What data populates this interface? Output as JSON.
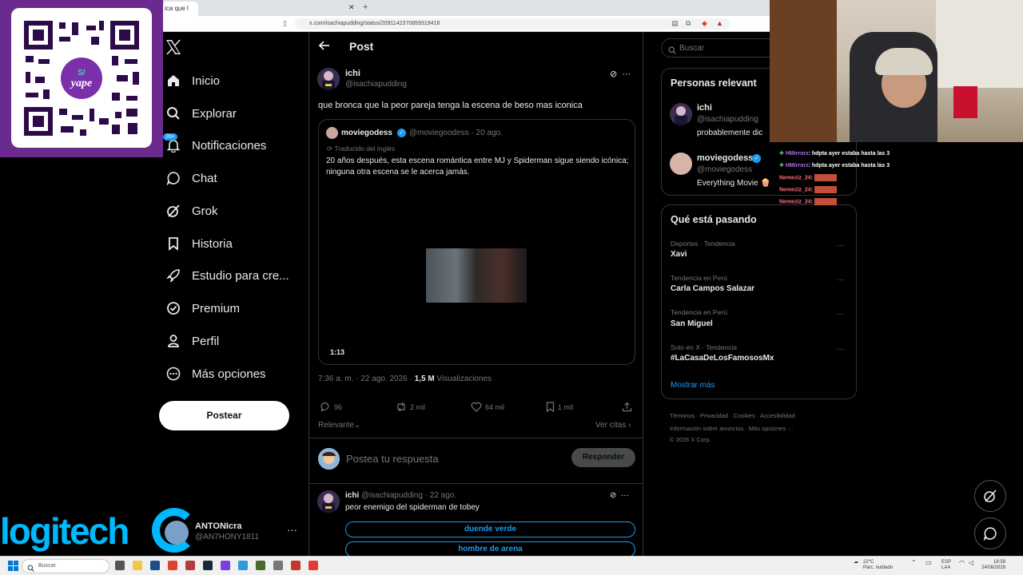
{
  "browser": {
    "tab_title": "ica que l",
    "address": "x.com/isachiapudding/status/2091142370859319416"
  },
  "overlays": {
    "qr_brand": "yape",
    "qr_currency": "S/",
    "logo_text": "logitech"
  },
  "nav": {
    "items": [
      {
        "label": "Inicio",
        "icon": "home-icon"
      },
      {
        "label": "Explorar",
        "icon": "search-icon"
      },
      {
        "label": "Notificaciones",
        "icon": "bell-icon",
        "badge": "20+"
      },
      {
        "label": "Chat",
        "icon": "chat-icon"
      },
      {
        "label": "Grok",
        "icon": "grok-icon"
      },
      {
        "label": "Historia",
        "icon": "bookmark-icon"
      },
      {
        "label": "Estudio para cre...",
        "icon": "rocket-icon"
      },
      {
        "label": "Premium",
        "icon": "verified-icon"
      },
      {
        "label": "Perfil",
        "icon": "person-icon"
      },
      {
        "label": "Más opciones",
        "icon": "more-circle-icon"
      }
    ],
    "post_button": "Postear",
    "account": {
      "name": "ANTONIcra",
      "handle": "@AN7HONY1811"
    }
  },
  "post": {
    "header": "Post",
    "author_name": "ichi",
    "author_handle": "@isachiapudding",
    "text": "que bronca que la peor pareja tenga la escena de beso mas iconica",
    "quote": {
      "name": "moviegodess",
      "handle": "@moviegoodess · 20 ago.",
      "translated": "Traducido del inglés",
      "text": "20 años después, esta escena romántica entre MJ y Spiderman sigue siendo icónica; ninguna otra escena se le acerca jamás.",
      "duration": "1:13"
    },
    "time": "7:36 a. m. · 22 ago. 2026 · ",
    "views_count": "1,5 M",
    "views_label": " Visualizaciones",
    "stats": {
      "replies": "96",
      "reposts": "2 mil",
      "likes": "64 mil",
      "bookmarks": "1 mil"
    },
    "sort": "Relevante",
    "quotes_link": "Ver citas ›",
    "reply_placeholder": "Postea tu respuesta",
    "reply_button": "Responder"
  },
  "reply": {
    "name": "ichi",
    "meta": " @isachiapudding · 22 ago.",
    "text": "peor enemigo del spiderman de tobey",
    "options": [
      "duende verde",
      "hombre de arena"
    ]
  },
  "sidebar": {
    "search_placeholder": "Buscar",
    "people_title": "Personas relevant",
    "people": [
      {
        "name": "ichi",
        "handle": "@isachiapudding",
        "bio": "probablemente dic"
      },
      {
        "name": "moviegodess",
        "handle": "@moviegodess",
        "bio": "Everything Movie 🍿"
      }
    ],
    "trends_title": "Qué está pasando",
    "trends": [
      {
        "category": "Deportes · Tendencia",
        "name": "Xavi"
      },
      {
        "category": "Tendencia en Perú",
        "name": "Carla Campos Salazar"
      },
      {
        "category": "Tendencia en Perú",
        "name": "San Miguel"
      },
      {
        "category": "Solo en X · Tendencia",
        "name": "#LaCasaDeLosFamososMx"
      }
    ],
    "show_more": "Mostrar más",
    "footer_1": "Términos  ·  Privacidad  ·  Cookies  ·  Accesibilidad  ·",
    "footer_2": "Información sobre anuncios  ·  Más opciones ···",
    "footer_3": "© 2026 X Corp."
  },
  "chat": [
    {
      "user": "HMirrorz",
      "msg": ": hdpta ayer estaba hasta las 3"
    },
    {
      "user": "HMirrorz",
      "msg": ": hdpta ayer estaba hasta las 3"
    },
    {
      "user": "Nemeziz_24",
      "msg": ":"
    },
    {
      "user": "Nemeziz_24",
      "msg": ":"
    },
    {
      "user": "Nemeziz_24",
      "msg": ":"
    }
  ],
  "taskbar": {
    "search": "Buscar",
    "weather": "22°C",
    "weather_desc": "Parc. nublado",
    "lang": "ESP",
    "lang2": "LAA",
    "time": "18:58",
    "date": "24/08/2026"
  }
}
